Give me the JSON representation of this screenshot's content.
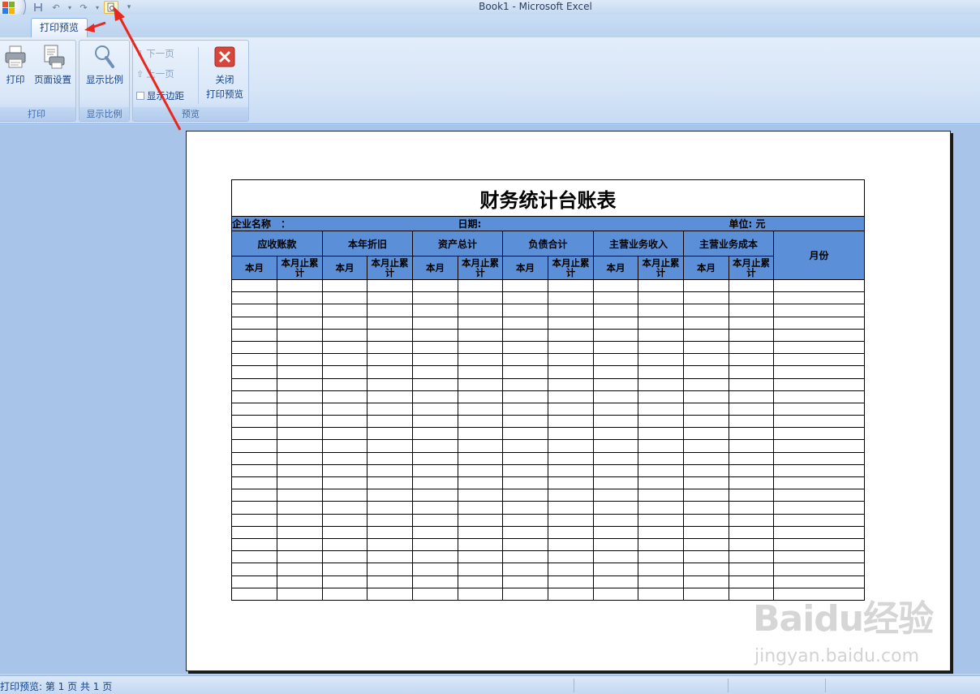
{
  "window": {
    "title": "Book1 - Microsoft Excel"
  },
  "tabs": [
    {
      "label": "打印预览"
    }
  ],
  "ribbon": {
    "groups": [
      {
        "label": "打印",
        "buttons": [
          {
            "label": "打印",
            "icon": "printer-icon"
          },
          {
            "label": "页面设置",
            "icon": "page-setup-icon"
          }
        ]
      },
      {
        "label": "显示比例",
        "buttons": [
          {
            "label": "显示比例",
            "icon": "zoom-icon"
          }
        ]
      },
      {
        "label": "预览",
        "small_buttons": [
          {
            "label": "下一页",
            "enabled": false
          },
          {
            "label": "上一页",
            "enabled": false
          }
        ],
        "checkbox": {
          "label": "显示边距",
          "checked": false
        },
        "close_button": {
          "line1": "关闭",
          "line2": "打印预览",
          "icon": "close-red-icon"
        }
      }
    ]
  },
  "sheet": {
    "title": "财务统计台账表",
    "company_label": "企业名称　：",
    "date_label": "日期:",
    "unit_label": "单位: 元",
    "group_headers": [
      "应收账款",
      "本年折旧",
      "资产总计",
      "负债合计",
      "主营业务收入",
      "主营业务成本"
    ],
    "sub_headers": [
      "本月",
      "本月止累计"
    ],
    "month_header": "月份",
    "empty_rows": 26
  },
  "status": {
    "text": "打印预览: 第 1 页  共 1 页"
  },
  "watermark": {
    "main": "Baidu经验",
    "sub": "jingyan.baidu.com"
  },
  "colors": {
    "header_blue": "#5b8fd8",
    "ribbon_text": "#15428b",
    "annotation_arrow": "#e8281e"
  }
}
